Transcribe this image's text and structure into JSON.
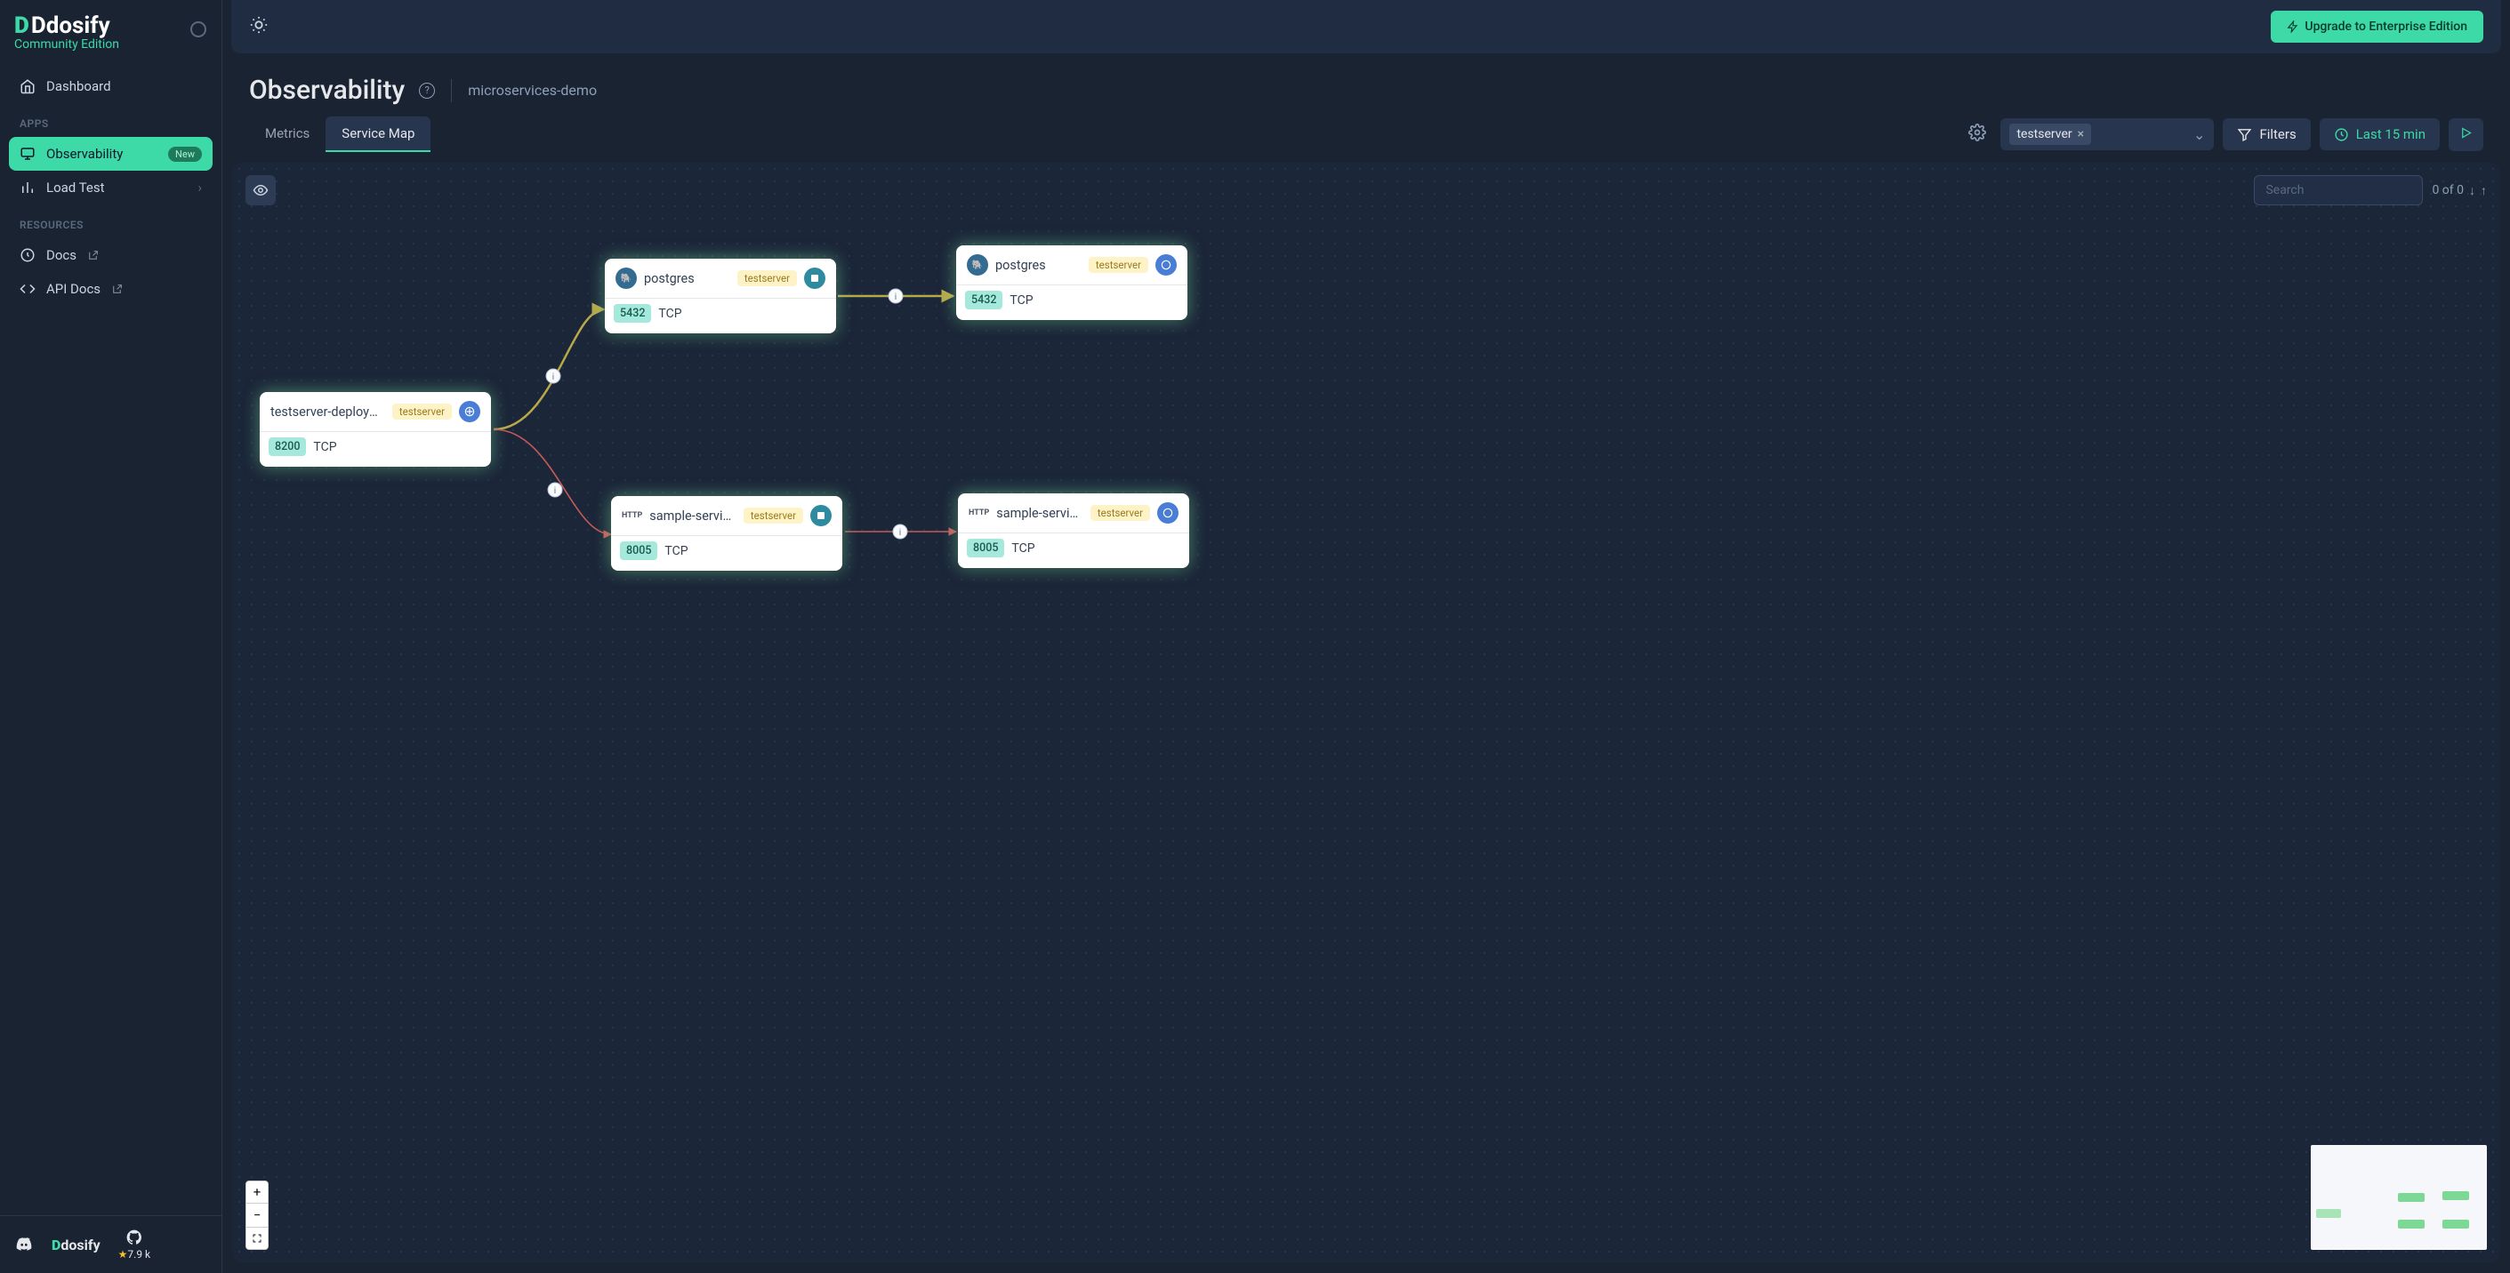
{
  "brand": {
    "name": "Ddosify",
    "edition": "Community Edition"
  },
  "nav": {
    "dashboard": "Dashboard",
    "apps_section": "APPS",
    "observability": "Observability",
    "obs_badge": "New",
    "load_test": "Load Test",
    "resources_section": "RESOURCES",
    "docs": "Docs",
    "api_docs": "API Docs"
  },
  "footer": {
    "stars": "7.9 k"
  },
  "topbar": {
    "upgrade": "Upgrade to Enterprise Edition"
  },
  "page": {
    "title": "Observability",
    "context": "microservices-demo"
  },
  "tabs": {
    "metrics": "Metrics",
    "service_map": "Service Map"
  },
  "filterbar": {
    "namespace_chip": "testserver",
    "filters_label": "Filters",
    "time_label": "Last 15 min"
  },
  "canvas": {
    "search_placeholder": "Search",
    "counter": "0 of 0"
  },
  "nodes": {
    "n1": {
      "title": "testserver-deployme...",
      "ns": "testserver",
      "port": "8200",
      "proto": "TCP"
    },
    "n2": {
      "title": "postgres",
      "ns": "testserver",
      "port": "5432",
      "proto": "TCP"
    },
    "n3": {
      "title": "postgres",
      "ns": "testserver",
      "port": "5432",
      "proto": "TCP"
    },
    "n4": {
      "title": "sample-service-curr...",
      "ns": "testserver",
      "port": "8005",
      "proto": "TCP"
    },
    "n5": {
      "title": "sample-service-curr...",
      "ns": "testserver",
      "port": "8005",
      "proto": "TCP"
    }
  }
}
